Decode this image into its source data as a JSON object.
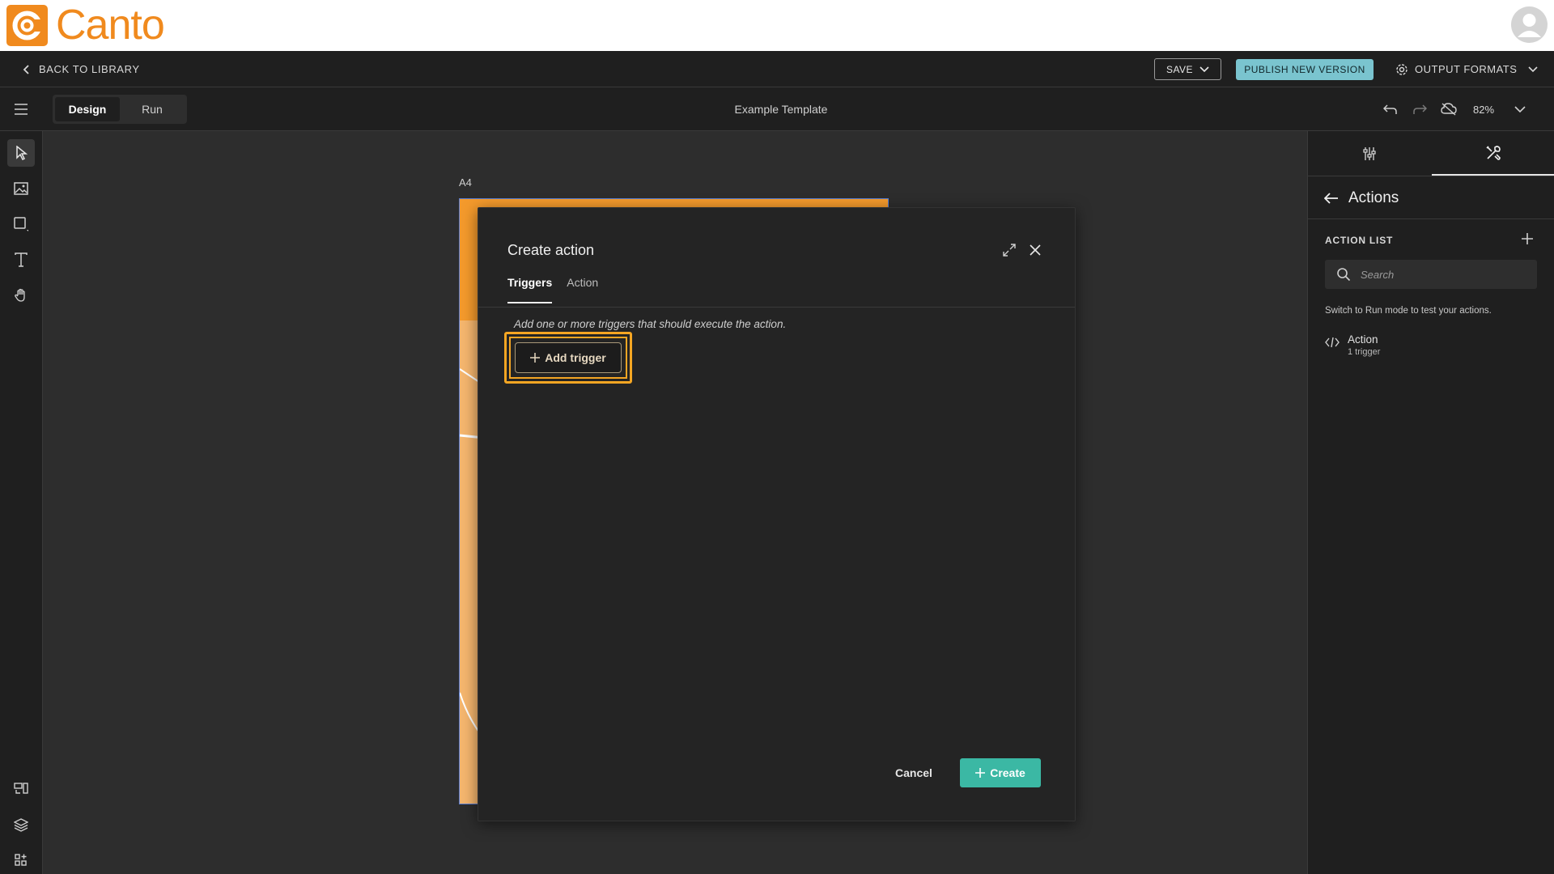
{
  "brand": {
    "name": "Canto",
    "color": "#f08a1e"
  },
  "nav": {
    "back_label": "BACK TO LIBRARY",
    "save_label": "SAVE",
    "publish_label": "PUBLISH NEW VERSION",
    "output_formats_label": "OUTPUT FORMATS"
  },
  "toolbar": {
    "modes": [
      {
        "label": "Design",
        "active": true
      },
      {
        "label": "Run",
        "active": false
      }
    ],
    "template_title": "Example Template",
    "zoom": "82%"
  },
  "left_tools": [
    {
      "name": "select-tool",
      "icon": "cursor-arrow-icon",
      "active": true
    },
    {
      "name": "image-tool",
      "icon": "image-icon",
      "active": false
    },
    {
      "name": "shape-tool",
      "icon": "square-icon",
      "active": false
    },
    {
      "name": "text-tool",
      "icon": "text-t-icon",
      "active": false
    },
    {
      "name": "pan-tool",
      "icon": "hand-icon",
      "active": false
    },
    {
      "name": "components-tool",
      "icon": "components-icon",
      "active": false
    },
    {
      "name": "layers-tool",
      "icon": "layers-icon",
      "active": false
    },
    {
      "name": "apps-tool",
      "icon": "apps-grid-icon",
      "active": false
    }
  ],
  "canvas": {
    "page_label": "A4"
  },
  "right_panel": {
    "tabs": [
      {
        "icon": "sliders-icon",
        "active": false
      },
      {
        "icon": "tools-icon",
        "active": true
      }
    ],
    "header": "Actions",
    "action_list_title": "ACTION LIST",
    "search_placeholder": "Search",
    "hint": "Switch to Run mode to test your actions.",
    "actions": [
      {
        "name": "Action",
        "sub": "1 trigger",
        "icon": "code-icon"
      }
    ]
  },
  "modal": {
    "title": "Create action",
    "tabs": [
      {
        "label": "Triggers",
        "active": true
      },
      {
        "label": "Action",
        "active": false
      }
    ],
    "hint": "Add one or more triggers that should execute the action.",
    "add_trigger_label": "Add trigger",
    "cancel_label": "Cancel",
    "create_label": "Create",
    "create_color": "#3bb8a4",
    "highlight_color": "#f5a623"
  }
}
